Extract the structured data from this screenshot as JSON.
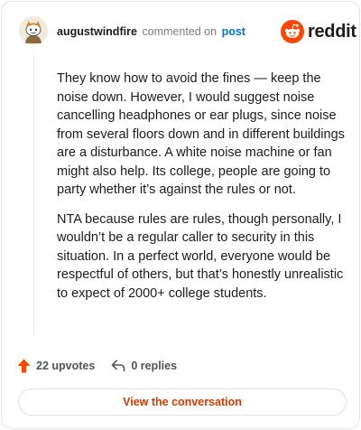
{
  "header": {
    "username": "augustwindfire",
    "action_text": "commented on",
    "post_link": "post"
  },
  "brand": {
    "name": "reddit",
    "accent": "#ff4500"
  },
  "comment": {
    "paragraphs": [
      "They know how to avoid the fines — keep the noise down. However, I would suggest noise cancelling headphones or ear plugs, since noise from several floors down and in different buildings are a disturbance. A white noise machine or fan might also help. Its college, people are going to party whether it’s against the rules or not.",
      "NTA because rules are rules, though personally, I wouldn’t be a regular caller to security in this situation. In a perfect world, everyone would be respectful of others, but that’s honestly unrealistic to expect of 2000+ college students."
    ]
  },
  "footer": {
    "upvotes": "22 upvotes",
    "replies": "0 replies"
  },
  "actions": {
    "view_conversation": "View the conversation"
  },
  "icons": {
    "avatar": "snoo-avatar-icon",
    "logo": "reddit-snoo-icon",
    "upvote": "upvote-arrow-icon",
    "reply": "reply-arrow-icon"
  },
  "colors": {
    "link": "#0079d3",
    "upvote": "#ff4500",
    "button_text": "#d93900"
  }
}
